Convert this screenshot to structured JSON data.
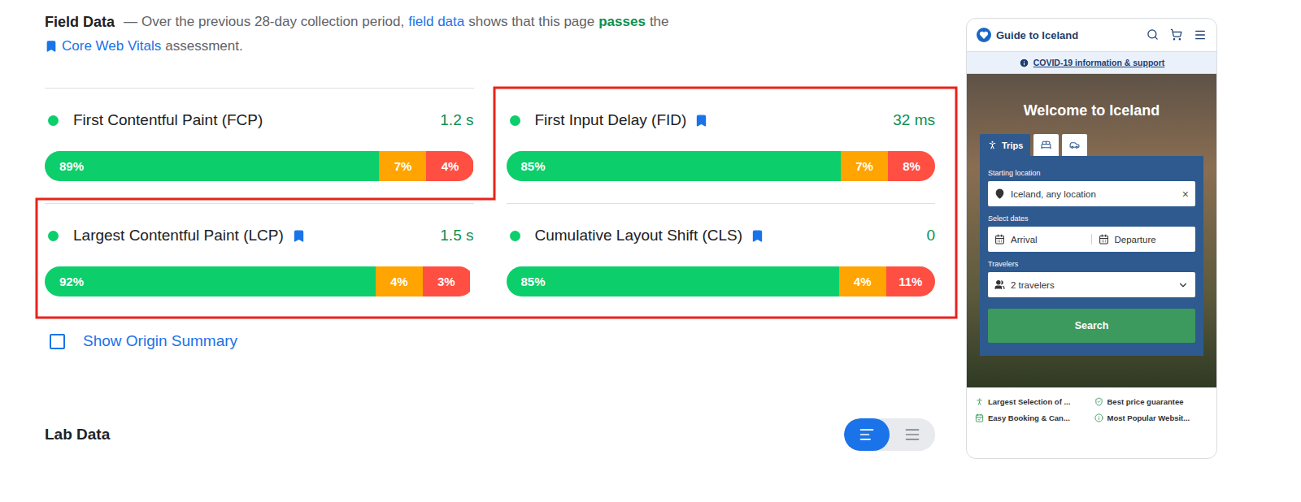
{
  "field_data": {
    "title": "Field Data",
    "dash": "—",
    "intro": "Over the previous 28-day collection period,",
    "link": "field data",
    "middle": "shows that this page",
    "verdict": "passes",
    "end": "the",
    "assessment_link": "Core Web Vitals",
    "assessment_end": "assessment.",
    "passed": true
  },
  "metrics": [
    {
      "name": "First Contentful Paint (FCP)",
      "value": "1.2 s",
      "core_web_vital": false,
      "highlighted": false,
      "status": "good",
      "distribution": [
        {
          "label": "89%",
          "level": 0.89,
          "color": "#0cce6b"
        },
        {
          "label": "7%",
          "level": 0.07,
          "color": "#ffa400"
        },
        {
          "label": "4%",
          "level": 0.04,
          "color": "#ff4e42"
        }
      ]
    },
    {
      "name": "First Input Delay (FID)",
      "value": "32 ms",
      "core_web_vital": true,
      "highlighted": true,
      "status": "good",
      "distribution": [
        {
          "label": "85%",
          "level": 0.85,
          "color": "#0cce6b"
        },
        {
          "label": "7%",
          "level": 0.07,
          "color": "#ffa400"
        },
        {
          "label": "8%",
          "level": 0.08,
          "color": "#ff4e42"
        }
      ]
    },
    {
      "name": "Largest Contentful Paint (LCP)",
      "value": "1.5 s",
      "core_web_vital": true,
      "highlighted": true,
      "status": "good",
      "distribution": [
        {
          "label": "92%",
          "level": 0.92,
          "color": "#0cce6b"
        },
        {
          "label": "4%",
          "level": 0.04,
          "color": "#ffa400"
        },
        {
          "label": "3%",
          "level": 0.03,
          "color": "#ff4e42"
        }
      ]
    },
    {
      "name": "Cumulative Layout Shift (CLS)",
      "value": "0",
      "core_web_vital": true,
      "highlighted": true,
      "status": "good",
      "distribution": [
        {
          "label": "85%",
          "level": 0.85,
          "color": "#0cce6b"
        },
        {
          "label": "4%",
          "level": 0.04,
          "color": "#ffa400"
        },
        {
          "label": "11%",
          "level": 0.11,
          "color": "#ff4e42"
        }
      ]
    }
  ],
  "origin_summary": {
    "label": "Show Origin Summary",
    "checked": false
  },
  "lab_data": {
    "title": "Lab Data",
    "view_toggle": [
      {
        "selected": true
      },
      {
        "selected": false
      }
    ]
  },
  "preview": {
    "brand": "Guide to Iceland",
    "notice": "COVID-19 information & support",
    "hero_title": "Welcome to Iceland",
    "tabs": [
      {
        "label": "Trips",
        "selected": true
      },
      {
        "selected": false
      },
      {
        "selected": false
      }
    ],
    "location": {
      "label": "Starting location",
      "value": "Iceland, any location",
      "clear": "×"
    },
    "dates": {
      "label": "Select dates",
      "arrival": "Arrival",
      "departure": "Departure"
    },
    "travelers": {
      "label": "Travelers",
      "value": "2 travelers"
    },
    "button": "Search",
    "features": [
      "Largest Selection of ...",
      "Best price guarantee",
      "Easy Booking & Can...",
      "Most Popular Websit..."
    ]
  }
}
